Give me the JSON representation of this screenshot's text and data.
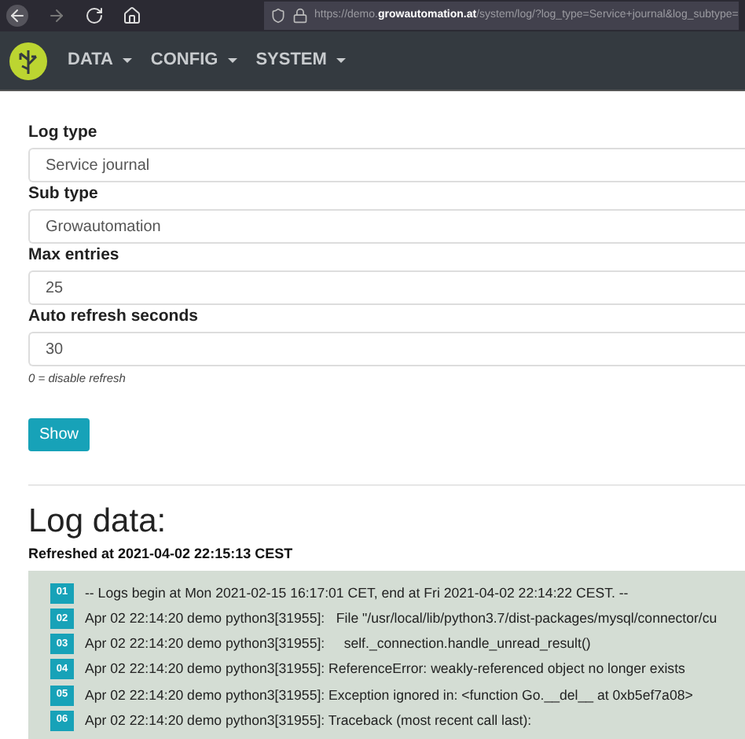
{
  "browser": {
    "url": "https://demo.**growautomation.at**/system/log/?log_type=Service+journal&log_subtype="
  },
  "navbar": {
    "items": [
      {
        "label": "DATA"
      },
      {
        "label": "CONFIG"
      },
      {
        "label": "SYSTEM"
      }
    ]
  },
  "form": {
    "fields": [
      {
        "label": "Log type",
        "value": "Service journal"
      },
      {
        "label": "Sub type",
        "value": "Growautomation"
      },
      {
        "label": "Max entries",
        "value": "25"
      },
      {
        "label": "Auto refresh seconds",
        "value": "30",
        "hint": "0 = disable refresh"
      }
    ],
    "button": "Show"
  },
  "log": {
    "title": "Log data:",
    "refreshed": "Refreshed at 2021-04-02 22:15:13 CEST",
    "lines": [
      {
        "number": "01",
        "text": "-- Logs begin at Mon 2021-02-15 16:17:01 CET, end at Fri 2021-04-02 22:14:22 CEST. --"
      },
      {
        "number": "02",
        "text": "Apr 02 22:14:20 demo python3[31955]:   File \"/usr/local/lib/python3.7/dist-packages/mysql/connector/cu"
      },
      {
        "number": "03",
        "text": "Apr 02 22:14:20 demo python3[31955]:     self._connection.handle_unread_result()"
      },
      {
        "number": "04",
        "text": "Apr 02 22:14:20 demo python3[31955]: ReferenceError: weakly-referenced object no longer exists"
      },
      {
        "number": "05",
        "text": "Apr 02 22:14:20 demo python3[31955]: Exception ignored in: <function Go.__del__ at 0xb5ef7a08>"
      },
      {
        "number": "06",
        "text": "Apr 02 22:14:20 demo python3[31955]: Traceback (most recent call last):"
      }
    ]
  }
}
